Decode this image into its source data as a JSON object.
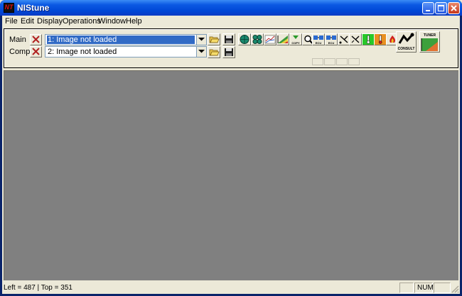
{
  "window": {
    "title": "NIStune",
    "logo_text": "NT",
    "colors": {
      "titlebar": "#0047d6",
      "workspace": "#808080",
      "selection": "#316ac5",
      "face": "#ece9d8"
    }
  },
  "menu": [
    "File",
    "Edit",
    "Display",
    "Operations",
    "Window",
    "Help"
  ],
  "toolbar": {
    "main_label": "Main",
    "comp_label": "Comp",
    "main_image": "1: Image not loaded",
    "comp_image": "2: Image not loaded",
    "icons": [
      "globe-icon",
      "grid-cells-icon",
      "graph-icon",
      "color-map-icon",
      "copy-icon",
      "zoom-icon",
      "ecu-read-icon",
      "ecu-write-icon",
      "tools-icon",
      "tools-alt-icon",
      "thermometer-green-icon",
      "thermometer-red-icon",
      "fire-icon"
    ],
    "icon_labels": {
      "copy": "COPY",
      "ecu_read": "ECU",
      "ecu_write": "ECU"
    },
    "consult_label": "CONSULT",
    "tuner_label": "TUNER"
  },
  "status": {
    "text": "Left = 487 | Top = 351",
    "num": "NUM"
  }
}
